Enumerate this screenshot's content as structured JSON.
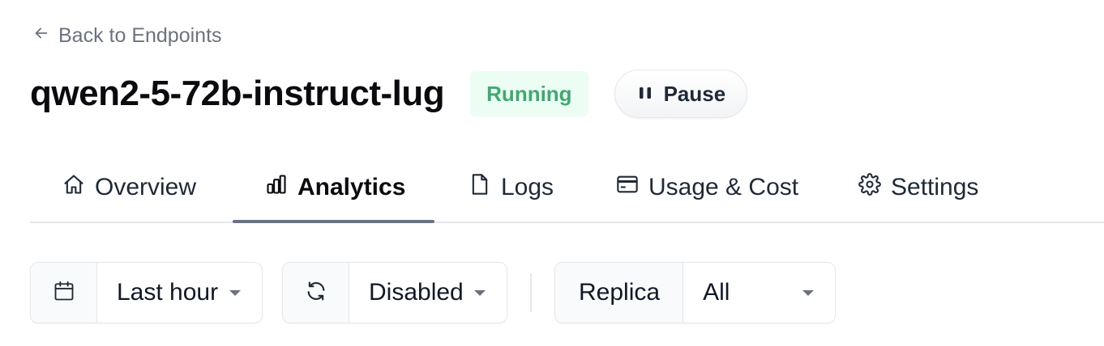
{
  "back_link": {
    "label": "Back to Endpoints"
  },
  "header": {
    "title": "qwen2-5-72b-instruct-lug",
    "status": "Running",
    "pause_label": "Pause"
  },
  "tabs": [
    {
      "label": "Overview",
      "icon": "home-icon"
    },
    {
      "label": "Analytics",
      "icon": "bar-chart-icon",
      "active": true
    },
    {
      "label": "Logs",
      "icon": "file-icon"
    },
    {
      "label": "Usage & Cost",
      "icon": "credit-card-icon"
    },
    {
      "label": "Settings",
      "icon": "gear-icon"
    }
  ],
  "filters": {
    "time_range": {
      "icon": "calendar-icon",
      "value": "Last hour"
    },
    "auto_refresh": {
      "icon": "refresh-icon",
      "value": "Disabled"
    },
    "replica": {
      "label": "Replica",
      "value": "All"
    }
  },
  "colors": {
    "status_bg": "#ecfdf3",
    "status_text": "#3fa971",
    "tab_underline": "#6b7280"
  }
}
